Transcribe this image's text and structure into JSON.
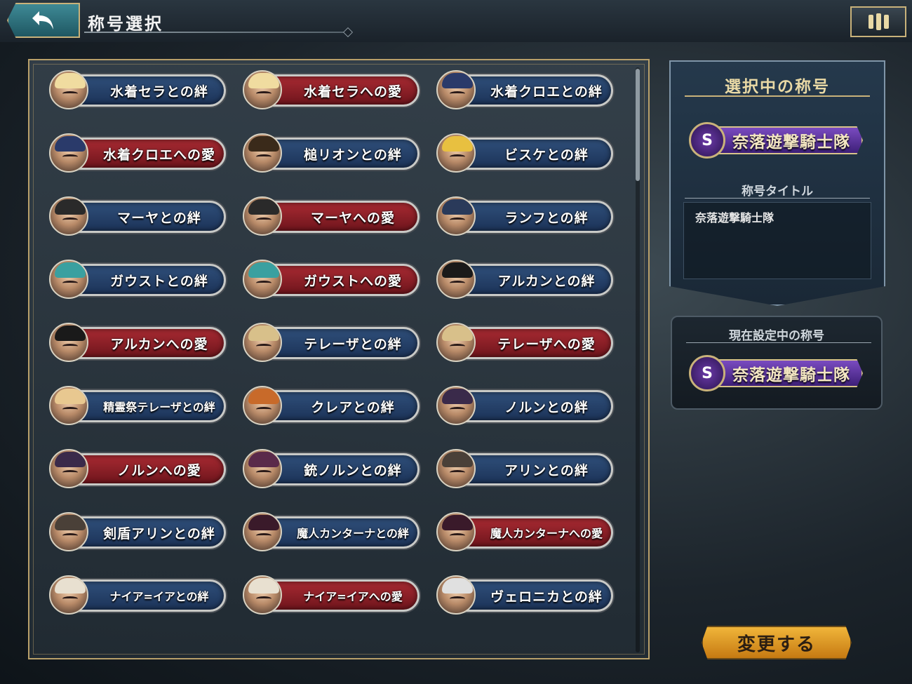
{
  "header": {
    "title": "称号選択"
  },
  "titles": [
    {
      "label": "水着セラとの絆",
      "kind": "bond",
      "hair": "#f0dca0"
    },
    {
      "label": "水着セラへの愛",
      "kind": "love",
      "hair": "#f0dca0"
    },
    {
      "label": "水着クロエとの絆",
      "kind": "bond",
      "hair": "#2a3a6a"
    },
    {
      "label": "水着クロエへの愛",
      "kind": "love",
      "hair": "#2a3a6a"
    },
    {
      "label": "槌リオンとの絆",
      "kind": "bond",
      "hair": "#3a2a1a"
    },
    {
      "label": "ビスケとの絆",
      "kind": "bond",
      "hair": "#e8c040"
    },
    {
      "label": "マーヤとの絆",
      "kind": "bond",
      "hair": "#2a2a2a"
    },
    {
      "label": "マーヤへの愛",
      "kind": "love",
      "hair": "#2a2a2a"
    },
    {
      "label": "ランフとの絆",
      "kind": "bond",
      "hair": "#2a3a5a"
    },
    {
      "label": "ガウストとの絆",
      "kind": "bond",
      "hair": "#3aa0a0"
    },
    {
      "label": "ガウストへの愛",
      "kind": "love",
      "hair": "#3aa0a0"
    },
    {
      "label": "アルカンとの絆",
      "kind": "bond",
      "hair": "#1a1a1a"
    },
    {
      "label": "アルカンへの愛",
      "kind": "love",
      "hair": "#1a1a1a"
    },
    {
      "label": "テレーザとの絆",
      "kind": "bond",
      "hair": "#d8c08a"
    },
    {
      "label": "テレーザへの愛",
      "kind": "love",
      "hair": "#d8c08a"
    },
    {
      "label": "精霊祭テレーザとの絆",
      "kind": "bond",
      "hair": "#e8c890"
    },
    {
      "label": "クレアとの絆",
      "kind": "bond",
      "hair": "#c86a2a"
    },
    {
      "label": "ノルンとの絆",
      "kind": "bond",
      "hair": "#3a2a4a"
    },
    {
      "label": "ノルンへの愛",
      "kind": "love",
      "hair": "#3a2a4a"
    },
    {
      "label": "銃ノルンとの絆",
      "kind": "bond",
      "hair": "#5a2a4a"
    },
    {
      "label": "アリンとの絆",
      "kind": "bond",
      "hair": "#4a4038"
    },
    {
      "label": "剣盾アリンとの絆",
      "kind": "bond",
      "hair": "#4a4038"
    },
    {
      "label": "魔人カンターナとの絆",
      "kind": "bond",
      "hair": "#3a1a2a"
    },
    {
      "label": "魔人カンターナへの愛",
      "kind": "love",
      "hair": "#3a1a2a"
    },
    {
      "label": "ナイア=イアとの絆",
      "kind": "bond",
      "hair": "#e8e0d0"
    },
    {
      "label": "ナイア=イアへの愛",
      "kind": "love",
      "hair": "#e8e0d0"
    },
    {
      "label": "ヴェロニカとの絆",
      "kind": "bond",
      "hair": "#e0e0e0"
    }
  ],
  "selected": {
    "heading": "選択中の称号",
    "badge_rank": "S",
    "badge_name": "奈落遊撃騎士隊",
    "title_label": "称号タイトル",
    "title_text": "奈落遊撃騎士隊"
  },
  "current": {
    "heading": "現在設定中の称号",
    "badge_rank": "S",
    "badge_name": "奈落遊撃騎士隊"
  },
  "change_button": "変更する"
}
